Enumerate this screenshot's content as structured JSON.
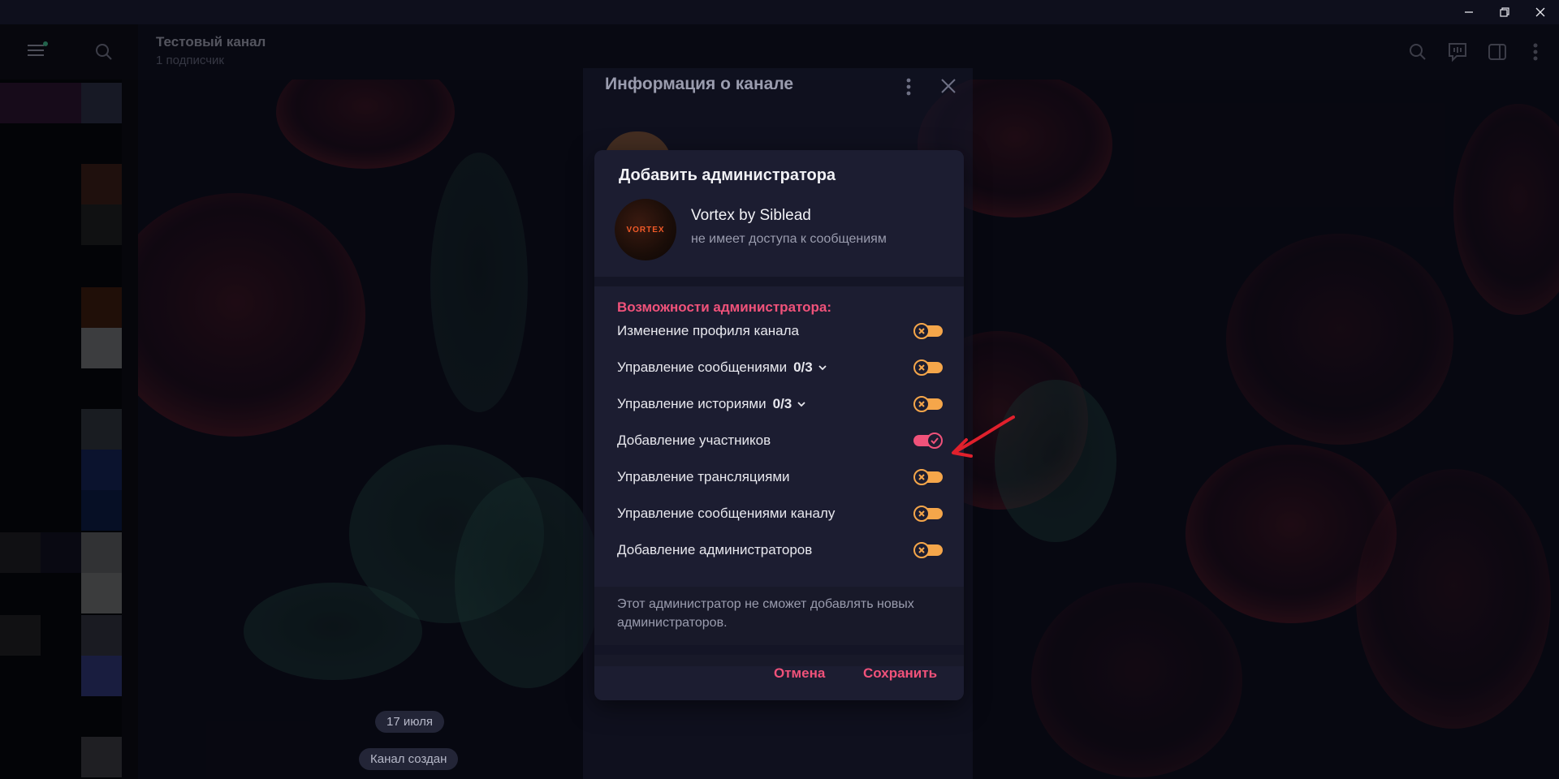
{
  "window": {
    "min_icon": "minimize-icon",
    "max_icon": "restore-icon",
    "close_icon": "close-icon"
  },
  "header": {
    "title": "Тестовый канал",
    "subtitle": "1 подписчик"
  },
  "info_panel": {
    "title": "Информация о канале"
  },
  "dialog": {
    "title": "Добавить администратора",
    "user": {
      "name": "Vortex by Siblead",
      "status": "не имеет доступа к сообщениям",
      "avatar_text": "VORTEX"
    },
    "section_title": "Возможности администратора:",
    "permissions": [
      {
        "label": "Изменение профиля канала",
        "count": "",
        "expandable": false,
        "enabled": false
      },
      {
        "label": "Управление сообщениями",
        "count": "0/3",
        "expandable": true,
        "enabled": false
      },
      {
        "label": "Управление историями",
        "count": "0/3",
        "expandable": true,
        "enabled": false
      },
      {
        "label": "Добавление участников",
        "count": "",
        "expandable": false,
        "enabled": true
      },
      {
        "label": "Управление трансляциями",
        "count": "",
        "expandable": false,
        "enabled": false
      },
      {
        "label": "Управление сообщениями каналу",
        "count": "",
        "expandable": false,
        "enabled": false
      },
      {
        "label": "Добавление администраторов",
        "count": "",
        "expandable": false,
        "enabled": false
      }
    ],
    "note": "Этот администратор не сможет добавлять новых администраторов.",
    "cancel_label": "Отмена",
    "save_label": "Сохранить"
  },
  "chat": {
    "date_pill": "17 июля",
    "service_message": "Канал создан"
  },
  "colors": {
    "accent": "#f0527a",
    "toggle_off": "#f5a64a",
    "toggle_on": "#f0527a",
    "dialog_bg": "#1c1d31",
    "arrow": "#e0202c"
  }
}
